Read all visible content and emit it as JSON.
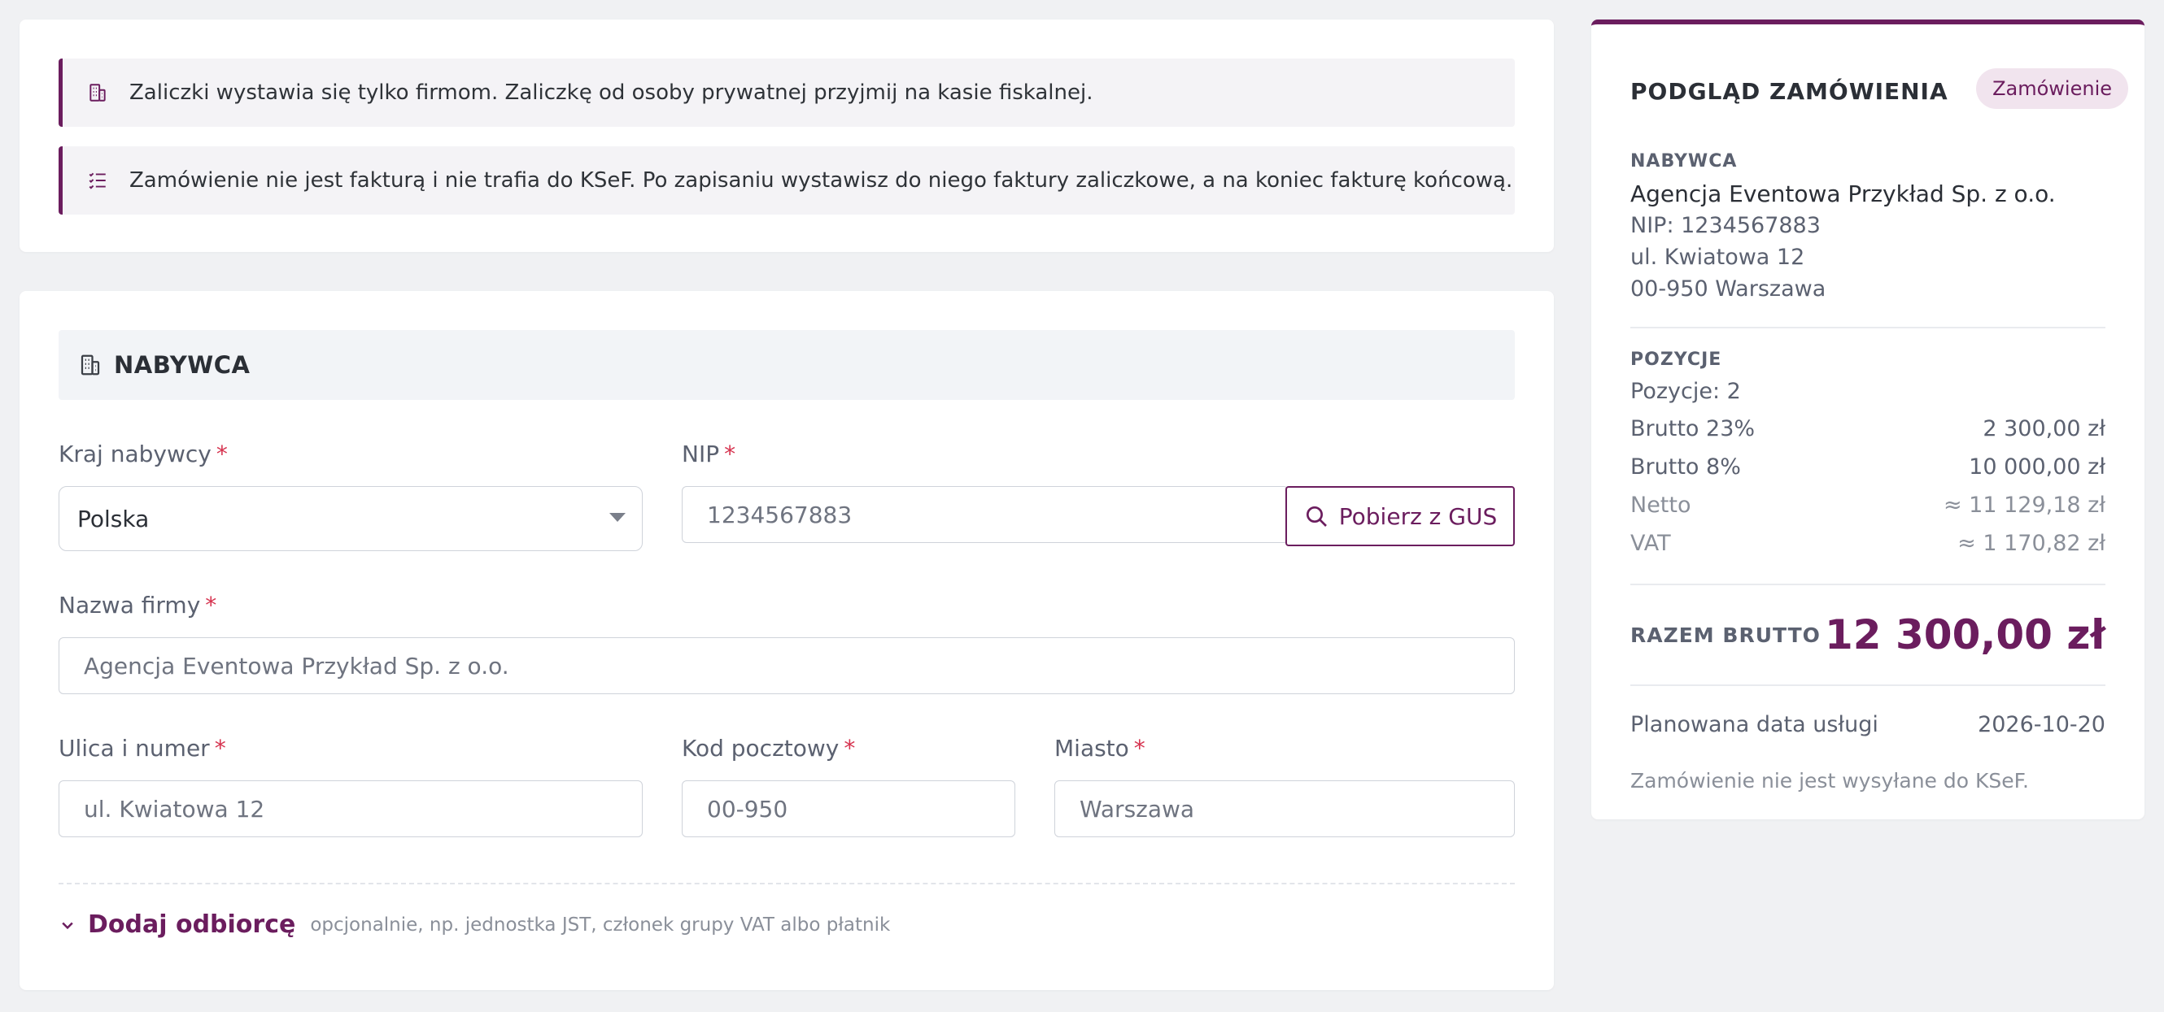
{
  "notes": [
    {
      "icon": "building-icon",
      "text": "Zaliczki wystawia się tylko firmom. Zaliczkę od osoby prywatnej przyjmij na kasie fiskalnej."
    },
    {
      "icon": "checklist-icon",
      "text": "Zamówienie nie jest fakturą i nie trafia do KSeF. Po zapisaniu wystawisz do niego faktury zaliczkowe, a na koniec fakturę końcową."
    }
  ],
  "buyer": {
    "title": "NABYWCA",
    "country_label": "Kraj nabywcy",
    "country_value": "Polska",
    "nip_label": "NIP",
    "nip_value": "1234567883",
    "gus_button": "Pobierz z GUS",
    "company_label": "Nazwa firmy",
    "company_value": "Agencja Eventowa Przykład Sp. z o.o.",
    "street_label": "Ulica i numer",
    "street_value": "ul. Kwiatowa 12",
    "postal_label": "Kod pocztowy",
    "postal_value": "00-950",
    "city_label": "Miasto",
    "city_value": "Warszawa",
    "required_mark": "*",
    "add_recipient_label": "Dodaj odbiorcę",
    "add_recipient_hint": "opcjonalnie, np. jednostka JST, członek grupy VAT albo płatnik"
  },
  "summary": {
    "title": "PODGLĄD ZAMÓWIENIA",
    "badge": "Zamówienie",
    "buyer_section": "NABYWCA",
    "buyer_name": "Agencja Eventowa Przykład Sp. z o.o.",
    "buyer_nip": "NIP: 1234567883",
    "buyer_street": "ul. Kwiatowa 12",
    "buyer_city": "00-950 Warszawa",
    "positions_section": "POZYCJE",
    "positions_count": "Pozycje: 2",
    "rows": [
      {
        "label": "Brutto 23%",
        "value": "2 300,00 zł"
      },
      {
        "label": "Brutto 8%",
        "value": "10 000,00 zł"
      },
      {
        "label": "Netto",
        "value": "≈ 11 129,18 zł"
      },
      {
        "label": "VAT",
        "value": "≈ 1 170,82 zł"
      }
    ],
    "total_label": "RAZEM BRUTTO",
    "total_value": "12 300,00 zł",
    "service_date_label": "Planowana data usługi",
    "service_date_value": "2026-10-20",
    "ksef_note": "Zamówienie nie jest wysyłane do KSeF."
  },
  "colors": {
    "accent": "#6b1d5e",
    "required": "#d6334f",
    "page_bg": "#f0f1f3"
  }
}
